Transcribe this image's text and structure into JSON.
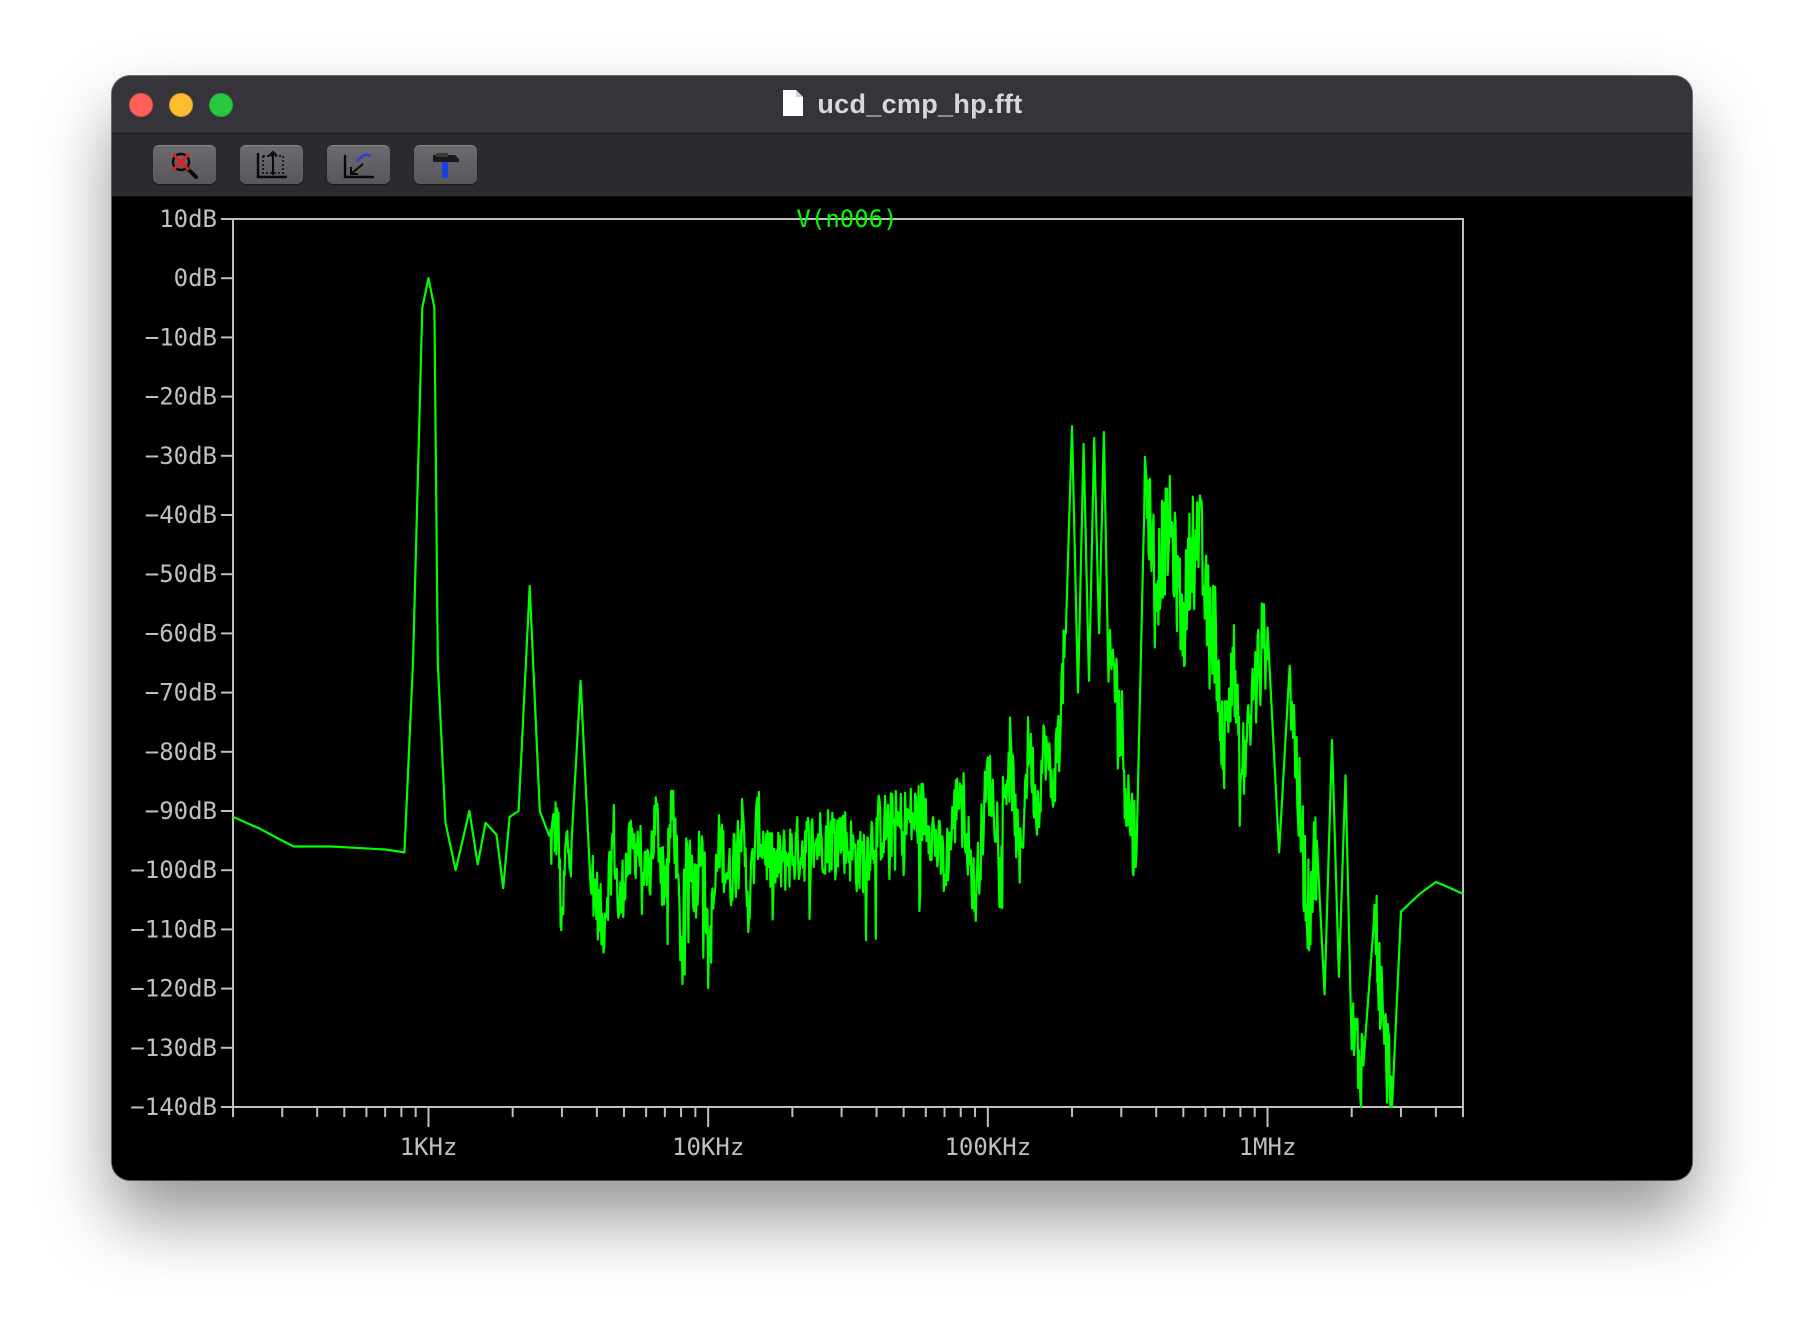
{
  "window": {
    "title": "ucd_cmp_hp.fft"
  },
  "toolbar": {
    "buttons": [
      {
        "icon": "zoom-cancel-icon"
      },
      {
        "icon": "autorange-icon"
      },
      {
        "icon": "zoom-back-icon"
      },
      {
        "icon": "hammer-icon"
      }
    ]
  },
  "colors": {
    "trace": "#00ff00",
    "axis": "#c0c0c0",
    "background": "#000000"
  },
  "chart_data": {
    "type": "line",
    "title": "V(n006)",
    "xscale": "log",
    "xlim": [
      200,
      5000000
    ],
    "ylim": [
      -140,
      10
    ],
    "x_tick_labels": [
      "1KHz",
      "10KHz",
      "100KHz",
      "1MHz"
    ],
    "x_tick_values": [
      1000,
      10000,
      100000,
      1000000
    ],
    "y_tick_labels": [
      "10dB",
      "0dB",
      "−10dB",
      "−20dB",
      "−30dB",
      "−40dB",
      "−50dB",
      "−60dB",
      "−70dB",
      "−80dB",
      "−90dB",
      "−100dB",
      "−110dB",
      "−120dB",
      "−130dB",
      "−140dB"
    ],
    "y_tick_values": [
      10,
      0,
      -10,
      -20,
      -30,
      -40,
      -50,
      -60,
      -70,
      -80,
      -90,
      -100,
      -110,
      -120,
      -130,
      -140
    ],
    "grid": false,
    "series": [
      {
        "name": "V(n006)",
        "x": [
          200,
          250,
          300,
          330,
          450,
          700,
          820,
          880,
          950,
          1000,
          1050,
          1080,
          1150,
          1250,
          1400,
          1500,
          1600,
          1750,
          1850,
          1950,
          2100,
          2300,
          2500,
          2700,
          2900,
          3000,
          3100,
          3250,
          3500,
          3800,
          4200,
          4600,
          4800,
          5000,
          5200,
          5600,
          6000,
          6500,
          7000,
          7500,
          8000,
          8500,
          9000,
          9500,
          10000,
          11000,
          12000,
          13000,
          14000,
          15000,
          17000,
          20000,
          25000,
          30000,
          35000,
          40000,
          50000,
          60000,
          70000,
          80000,
          90000,
          100000,
          110000,
          120000,
          130000,
          140000,
          150000,
          160000,
          170000,
          180000,
          190000,
          200000,
          210000,
          220000,
          230000,
          240000,
          250000,
          260000,
          270000,
          280000,
          300000,
          320000,
          340000,
          360000,
          380000,
          400000,
          420000,
          450000,
          480000,
          500000,
          520000,
          550000,
          580000,
          600000,
          650000,
          700000,
          750000,
          800000,
          900000,
          1000000,
          1100000,
          1200000,
          1300000,
          1400000,
          1500000,
          1600000,
          1700000,
          1800000,
          1900000,
          2000000,
          2200000,
          2400000,
          2600000,
          2800000,
          3000000,
          3500000,
          4000000,
          4500000,
          5000000
        ],
        "y": [
          -91,
          -93,
          -95,
          -96,
          -96,
          -96.5,
          -97,
          -65,
          -5,
          0,
          -5,
          -65,
          -92,
          -100,
          -90,
          -99,
          -92,
          -94,
          -103,
          -91,
          -90,
          -52,
          -90,
          -96,
          -92,
          -112,
          -96,
          -95,
          -68,
          -100,
          -110,
          -94,
          -108,
          -101,
          -98,
          -95,
          -103,
          -91,
          -102,
          -89,
          -113,
          -95,
          -104,
          -92,
          -115,
          -95,
          -102,
          -90,
          -106,
          -92,
          -100,
          -97,
          -95,
          -94,
          -99,
          -93,
          -92,
          -90,
          -100,
          -85,
          -105,
          -84,
          -93,
          -80,
          -100,
          -78,
          -90,
          -78,
          -87,
          -76,
          -60,
          -25,
          -70,
          -28,
          -68,
          -27,
          -60,
          -26,
          -70,
          -65,
          -76,
          -90,
          -97,
          -36,
          -40,
          -52,
          -46,
          -42,
          -53,
          -60,
          -50,
          -40,
          -46,
          -55,
          -60,
          -80,
          -62,
          -86,
          -69,
          -59,
          -97,
          -66,
          -90,
          -107,
          -95,
          -121,
          -78,
          -118,
          -84,
          -129,
          -133,
          -105,
          -128,
          -138,
          -107,
          -104,
          -102,
          -103,
          -104
        ],
        "style": "noisy"
      }
    ]
  }
}
